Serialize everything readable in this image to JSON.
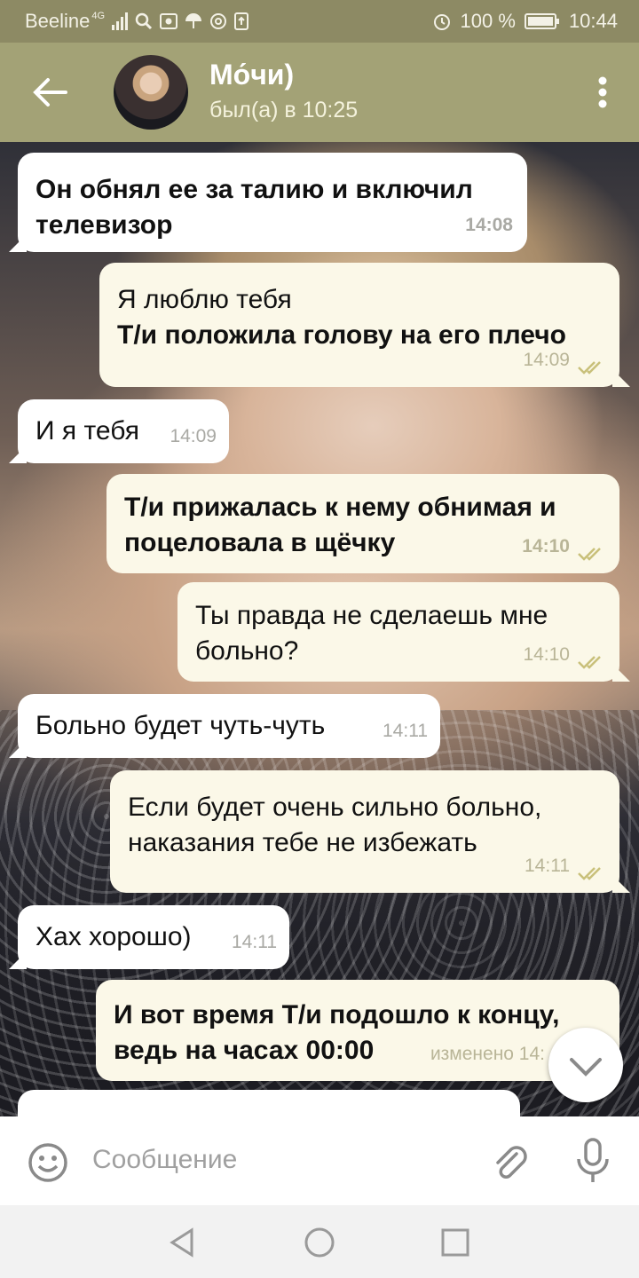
{
  "status_bar": {
    "carrier": "Beeline",
    "network": "4G",
    "battery": "100 %",
    "time": "10:44"
  },
  "header": {
    "contact_name": "Мо́чи)",
    "last_seen": "был(а) в 10:25"
  },
  "messages": [
    {
      "direction": "in",
      "text": "Он обнял ее за талию и включил телевизор",
      "time": "14:08",
      "bold": true
    },
    {
      "direction": "out",
      "lines": [
        "Я люблю тебя",
        "Т/и положила голову на его плечо"
      ],
      "time": "14:09",
      "read": true
    },
    {
      "direction": "in",
      "text": "И я тебя",
      "time": "14:09"
    },
    {
      "direction": "out",
      "text": "Т/и прижалась к нему обнимая и поцеловала в щёчку",
      "time": "14:10",
      "read": true,
      "bold": true
    },
    {
      "direction": "out",
      "text": "Ты правда не сделаешь мне больно?",
      "time": "14:10",
      "read": true
    },
    {
      "direction": "in",
      "text": "Больно будет чуть-чуть",
      "time": "14:11"
    },
    {
      "direction": "out",
      "text": "Если будет очень сильно больно, наказания тебе не избежать",
      "time": "14:11",
      "read": true
    },
    {
      "direction": "in",
      "text": "Хах хорошо)",
      "time": "14:11"
    },
    {
      "direction": "out",
      "text": "И вот время Т/и подошло к концу, ведь на часах 00:00",
      "time": "изменено 14:",
      "bold": true
    }
  ],
  "input": {
    "placeholder": "Сообщение"
  },
  "colors": {
    "header_bg": "#a3a276",
    "status_bg": "#8d8a64",
    "incoming_bubble": "#ffffff",
    "outgoing_bubble": "#fbf8e8",
    "read_ticks": "#c9c07a"
  },
  "icons": [
    "back-arrow-icon",
    "more-vert-icon",
    "emoji-icon",
    "attach-icon",
    "mic-icon",
    "chevron-down-icon",
    "nav-back-icon",
    "nav-home-icon",
    "nav-recents-icon"
  ]
}
